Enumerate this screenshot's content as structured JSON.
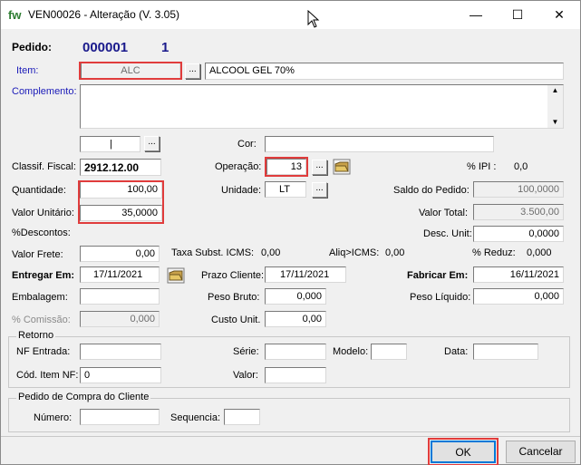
{
  "window": {
    "app_logo": "fw",
    "title": "VEN00026 - Alteração  (V. 3.05)",
    "minimize": "—",
    "maximize": "☐",
    "close": "✕"
  },
  "header": {
    "pedido_label": "Pedido:",
    "pedido_number": "000001",
    "pedido_seq": "1"
  },
  "item": {
    "label": "Item:",
    "code": "ALC",
    "description": "ALCOOL GEL 70%",
    "lookup": "..."
  },
  "complemento": {
    "label": "Complemento:",
    "value": ""
  },
  "aux": {
    "field": "|",
    "lookup": "..."
  },
  "cor": {
    "label": "Cor:",
    "value": ""
  },
  "classif_fiscal": {
    "label": "Classif. Fiscal:",
    "value": "2912.12.00"
  },
  "operacao": {
    "label": "Operação:",
    "value": "13",
    "lookup": "..."
  },
  "ipi": {
    "label": "% IPI :",
    "value": "0,0"
  },
  "quantidade": {
    "label": "Quantidade:",
    "value": "100,00"
  },
  "unidade": {
    "label": "Unidade:",
    "value": "LT",
    "lookup": "..."
  },
  "saldo_pedido": {
    "label": "Saldo do Pedido:",
    "value": "100,0000"
  },
  "valor_unitario": {
    "label": "Valor Unitário:",
    "value": "35,0000"
  },
  "valor_total": {
    "label": "Valor Total:",
    "value": "3.500,00"
  },
  "descontos": {
    "label": "%Descontos:"
  },
  "desc_unit": {
    "label": "Desc. Unit:",
    "value": "0,0000"
  },
  "valor_frete": {
    "label": "Valor Frete:",
    "value": "0,00"
  },
  "taxa_icms": {
    "label": "Taxa Subst. ICMS:",
    "value": "0,00"
  },
  "aliq_icms": {
    "label": "Aliq>ICMS:",
    "value": "0,00"
  },
  "reduz": {
    "label": "% Reduz:",
    "value": "0,000"
  },
  "entregar_em": {
    "label": "Entregar Em:",
    "value": "17/11/2021"
  },
  "prazo_cliente": {
    "label": "Prazo Cliente:",
    "value": "17/11/2021"
  },
  "fabricar_em": {
    "label": "Fabricar Em:",
    "value": "16/11/2021"
  },
  "embalagem": {
    "label": "Embalagem:",
    "value": ""
  },
  "peso_bruto": {
    "label": "Peso Bruto:",
    "value": "0,000"
  },
  "peso_liquido": {
    "label": "Peso Líquido:",
    "value": "0,000"
  },
  "comissao": {
    "label": "% Comissão:",
    "value": "0,000"
  },
  "custo_unit": {
    "label": "Custo Unit.",
    "value": "0,00"
  },
  "retorno": {
    "legend": "Retorno",
    "nf_entrada_label": "NF Entrada:",
    "nf_entrada": "",
    "serie_label": "Série:",
    "serie": "",
    "modelo_label": "Modelo:",
    "modelo": "",
    "data_label": "Data:",
    "data": "",
    "cod_item_label": "Cód. Item NF:",
    "cod_item": "0",
    "valor_label": "Valor:",
    "valor": ""
  },
  "pedido_compra": {
    "legend": "Pedido de Compra do Cliente",
    "numero_label": "Número:",
    "numero": "",
    "sequencia_label": "Sequencia:",
    "sequencia": ""
  },
  "buttons": {
    "ok": "OK",
    "cancelar": "Cancelar"
  },
  "colors": {
    "highlight": "#e03c3c",
    "label_blue": "#1a1ab8",
    "number_blue": "#1a1a8c"
  }
}
